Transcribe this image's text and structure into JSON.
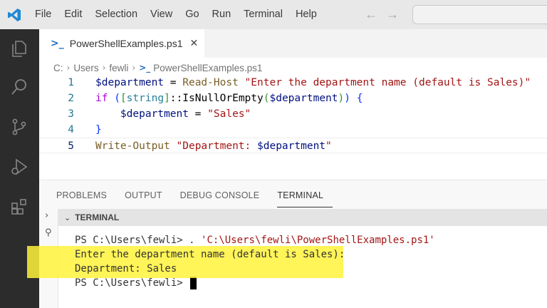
{
  "menu": [
    "File",
    "Edit",
    "Selection",
    "View",
    "Go",
    "Run",
    "Terminal",
    "Help"
  ],
  "nav": {
    "back_icon": "arrow-left",
    "forward_icon": "arrow-right"
  },
  "activity_bar": [
    "explorer-icon",
    "search-icon",
    "source-control-icon",
    "run-debug-icon",
    "extensions-icon"
  ],
  "editor": {
    "tab": {
      "label": "PowerShellExamples.ps1",
      "icon": "powershell-icon",
      "close": "✕"
    },
    "breadcrumb": [
      "C:",
      "Users",
      "fewli",
      "PowerShellExamples.ps1"
    ],
    "lines": [
      {
        "n": "1",
        "parts": [
          [
            "$department",
            "var"
          ],
          [
            " = ",
            "op"
          ],
          [
            "Read-Host",
            "cmd"
          ],
          [
            " ",
            "op"
          ],
          [
            "\"Enter the department name (default is Sales)\"",
            "str"
          ]
        ]
      },
      {
        "n": "2",
        "parts": [
          [
            "if",
            "kw"
          ],
          [
            " ",
            "op"
          ],
          [
            "(",
            "brace1"
          ],
          [
            "[",
            "brace2"
          ],
          [
            "string",
            "type"
          ],
          [
            "]",
            "brace2"
          ],
          [
            "::IsNullOrEmpty",
            "op"
          ],
          [
            "(",
            "brace2"
          ],
          [
            "$department",
            "var"
          ],
          [
            ")",
            "brace2"
          ],
          [
            ")",
            "brace1"
          ],
          [
            " ",
            "op"
          ],
          [
            "{",
            "brace1"
          ]
        ]
      },
      {
        "n": "3",
        "parts": [
          [
            "    ",
            "op"
          ],
          [
            "$department",
            "var"
          ],
          [
            " = ",
            "op"
          ],
          [
            "\"Sales\"",
            "str"
          ]
        ]
      },
      {
        "n": "4",
        "parts": [
          [
            "}",
            "brace1"
          ]
        ]
      },
      {
        "n": "5",
        "parts": [
          [
            "Write-Output",
            "cmd"
          ],
          [
            " ",
            "op"
          ],
          [
            "\"Department: ",
            "str"
          ],
          [
            "$department",
            "var"
          ],
          [
            "\"",
            "str"
          ]
        ]
      }
    ],
    "active_line": "5"
  },
  "panel": {
    "tabs": [
      "PROBLEMS",
      "OUTPUT",
      "DEBUG CONSOLE",
      "TERMINAL"
    ],
    "active_tab": "TERMINAL",
    "terminal_header": "TERMINAL",
    "terminal_lines": [
      {
        "prompt": "PS C:\\Users\\fewli> ",
        "cmd": ". ",
        "path": "'C:\\Users\\fewli\\PowerShellExamples.ps1'"
      },
      {
        "text": "Enter the department name (default is Sales):"
      },
      {
        "text": "Department: Sales"
      },
      {
        "prompt": "PS C:\\Users\\fewli> "
      }
    ]
  },
  "colors": {
    "highlight": "#fff23b",
    "activity_bar": "#2c2c2c",
    "accent": "#0078d4"
  }
}
